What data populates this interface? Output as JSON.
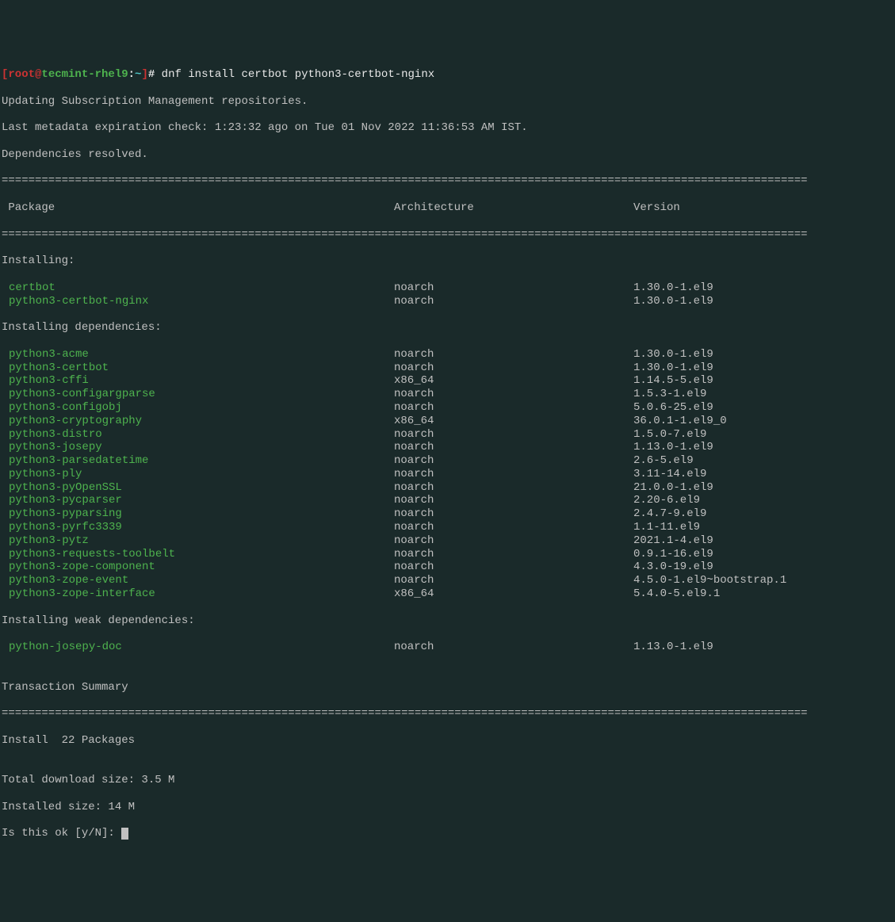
{
  "prompt": {
    "bracket_open": "[",
    "user": "root",
    "at": "@",
    "host": "tecmint-rhel9",
    "colon": ":",
    "path": "~",
    "bracket_close": "]",
    "hash": "# ",
    "command": "dnf install certbot python3-certbot-nginx"
  },
  "lines": {
    "updating": "Updating Subscription Management repositories.",
    "metadata": "Last metadata expiration check: 1:23:32 ago on Tue 01 Nov 2022 11:36:53 AM IST.",
    "resolved": "Dependencies resolved."
  },
  "separator1": "=========================================================================================================================",
  "headers": {
    "pkg": " Package",
    "arch": "Architecture",
    "ver": "Version"
  },
  "separator2": "=========================================================================================================================",
  "sections": {
    "installing": "Installing:",
    "installing_deps": "Installing dependencies:",
    "installing_weak": "Installing weak dependencies:"
  },
  "installing": [
    {
      "name": "certbot",
      "arch": "noarch",
      "ver": "1.30.0-1.el9"
    },
    {
      "name": "python3-certbot-nginx",
      "arch": "noarch",
      "ver": "1.30.0-1.el9"
    }
  ],
  "deps": [
    {
      "name": "python3-acme",
      "arch": "noarch",
      "ver": "1.30.0-1.el9"
    },
    {
      "name": "python3-certbot",
      "arch": "noarch",
      "ver": "1.30.0-1.el9"
    },
    {
      "name": "python3-cffi",
      "arch": "x86_64",
      "ver": "1.14.5-5.el9"
    },
    {
      "name": "python3-configargparse",
      "arch": "noarch",
      "ver": "1.5.3-1.el9"
    },
    {
      "name": "python3-configobj",
      "arch": "noarch",
      "ver": "5.0.6-25.el9"
    },
    {
      "name": "python3-cryptography",
      "arch": "x86_64",
      "ver": "36.0.1-1.el9_0"
    },
    {
      "name": "python3-distro",
      "arch": "noarch",
      "ver": "1.5.0-7.el9"
    },
    {
      "name": "python3-josepy",
      "arch": "noarch",
      "ver": "1.13.0-1.el9"
    },
    {
      "name": "python3-parsedatetime",
      "arch": "noarch",
      "ver": "2.6-5.el9"
    },
    {
      "name": "python3-ply",
      "arch": "noarch",
      "ver": "3.11-14.el9"
    },
    {
      "name": "python3-pyOpenSSL",
      "arch": "noarch",
      "ver": "21.0.0-1.el9"
    },
    {
      "name": "python3-pycparser",
      "arch": "noarch",
      "ver": "2.20-6.el9"
    },
    {
      "name": "python3-pyparsing",
      "arch": "noarch",
      "ver": "2.4.7-9.el9"
    },
    {
      "name": "python3-pyrfc3339",
      "arch": "noarch",
      "ver": "1.1-11.el9"
    },
    {
      "name": "python3-pytz",
      "arch": "noarch",
      "ver": "2021.1-4.el9"
    },
    {
      "name": "python3-requests-toolbelt",
      "arch": "noarch",
      "ver": "0.9.1-16.el9"
    },
    {
      "name": "python3-zope-component",
      "arch": "noarch",
      "ver": "4.3.0-19.el9"
    },
    {
      "name": "python3-zope-event",
      "arch": "noarch",
      "ver": "4.5.0-1.el9~bootstrap.1"
    },
    {
      "name": "python3-zope-interface",
      "arch": "x86_64",
      "ver": "5.4.0-5.el9.1"
    }
  ],
  "weak": [
    {
      "name": "python-josepy-doc",
      "arch": "noarch",
      "ver": "1.13.0-1.el9"
    }
  ],
  "summary": {
    "blank": "",
    "title": "Transaction Summary",
    "sep": "=========================================================================================================================",
    "install_count": "Install  22 Packages",
    "blank2": "",
    "download_size": "Total download size: 3.5 M",
    "installed_size": "Installed size: 14 M",
    "confirm": "Is this ok [y/N]: "
  }
}
